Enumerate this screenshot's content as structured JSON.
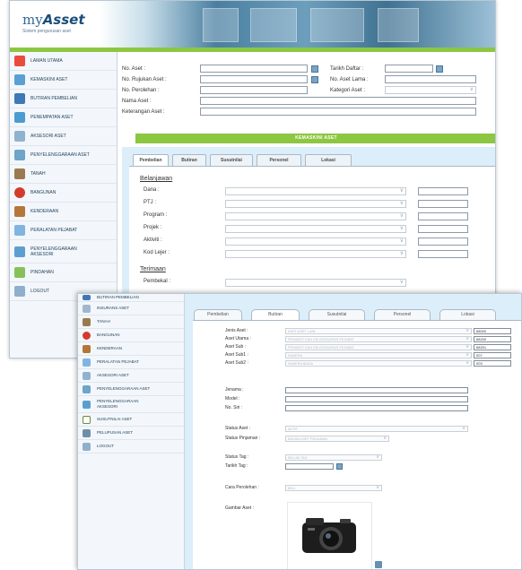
{
  "brand": {
    "logo_prefix": "my",
    "logo_name": "Asset",
    "tagline": "Sistem pengurusan aset"
  },
  "sidebar_main": [
    "Laman Utama",
    "Kemaskini Aset",
    "Butiran Pembelian",
    "Penempatan Aset",
    "Aksesori Aset",
    "Penyelenggaraan Aset",
    "Tanah",
    "Bangunan",
    "Kenderaan",
    "Peralatan Pejabat",
    "Penyelenggaraan Aksesori",
    "Pindahan",
    "Logout"
  ],
  "sidebar_front": [
    "Butiran Pembelian",
    "Insurans Aset",
    "Tanah",
    "Bangunan",
    "Kenderaan",
    "Peralatan Pejabat",
    "Aksesori Aset",
    "Penyelenggaraan Aset",
    "Penyelenggaraan Aksesori",
    "Susutnilai Aset",
    "Pelupusan Aset",
    "Logout"
  ],
  "form_top": {
    "no_aset": "No. Aset :",
    "no_rujukan": "No. Rujukan Aset :",
    "no_perolehan": "No. Perolehan :",
    "nama_aset": "Nama Aset :",
    "keterangan": "Keterangan Aset :",
    "tarikh_daftar": "Tarikh Daftar :",
    "no_aset_lama": "No. Aset Lama :",
    "kategori": "Kategori Aset :"
  },
  "section_bar": "KEMASKINI ASET",
  "tabs_back": [
    "Pembelian",
    "Butiran",
    "Susutnilai",
    "Personel",
    "Lokasi"
  ],
  "tabs_front": [
    "Pembelian",
    "Butiran",
    "Susutnilai",
    "Personel",
    "Lokasi"
  ],
  "belanjawan": {
    "heading": "Belanjawan",
    "fields": [
      "Dana :",
      "PTJ :",
      "Program :",
      "Projek :",
      "Aktiviti :",
      "Kod Lejer :"
    ]
  },
  "terimaan": {
    "heading": "Terimaan",
    "pembekal": "Pembekal :"
  },
  "butiran": {
    "jenis_aset": "Jenis Aset :",
    "aset_utama": "Aset Utama :",
    "aset_sub": "Aset Sub :",
    "aset_sub1": "Aset Sub1 :",
    "aset_sub2": "Aset Sub2 :",
    "jenis_val": "ASET-ASET LAIN",
    "utama_val": "PERABOT DAN KELENGKAPAN PEJABAT",
    "sub_val": "PERABOT DAN KELENGKAPAN PEJABAT",
    "sub1_val": "KAMERA",
    "sub2_val": "KAMERA BIASA",
    "codes": [
      "68000",
      "68200",
      "68201",
      "007",
      "003"
    ],
    "jenama": "Jenama :",
    "model": "Model :",
    "no_siri": "No. Siri :",
    "status_aset": "Status Aset :",
    "status_aset_val": "AKTIF",
    "status_pinjaman": "Status Pinjaman :",
    "status_pinjaman_val": "BUKAN ASET PINJAMAN",
    "status_tag": "Status Tag :",
    "status_tag_val": "BELUM TAG",
    "tarikh_tag": "Tarikh Tag :",
    "cara_perolehan": "Cara Perolehan :",
    "cara_perolehan_val": "BELI",
    "gambar_aset": "Gambar Aset :"
  },
  "colors": {
    "accent_green": "#8dc641",
    "panel_blue": "#dceefa",
    "brand_blue": "#2f6a97"
  }
}
